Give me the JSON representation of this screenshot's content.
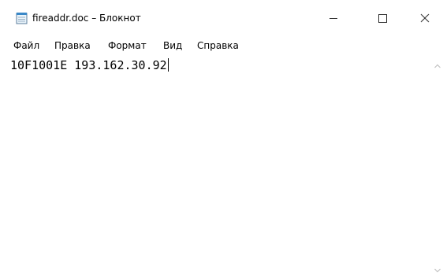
{
  "window": {
    "title": "fireaddr.doc – Блокнот"
  },
  "menu": {
    "items": [
      {
        "label": "Файл"
      },
      {
        "label": "Правка"
      },
      {
        "label": "Формат"
      },
      {
        "label": "Вид"
      },
      {
        "label": "Справка"
      }
    ]
  },
  "editor": {
    "content": "10F1001E 193.162.30.92"
  },
  "colors": {
    "background": "#ffffff",
    "text": "#000000",
    "glyph": "#333333",
    "scroll_arrow": "#c2c2c2"
  },
  "icons": {
    "app": "notepad-icon",
    "minimize": "minimize-icon",
    "maximize": "maximize-icon",
    "close": "close-icon"
  }
}
